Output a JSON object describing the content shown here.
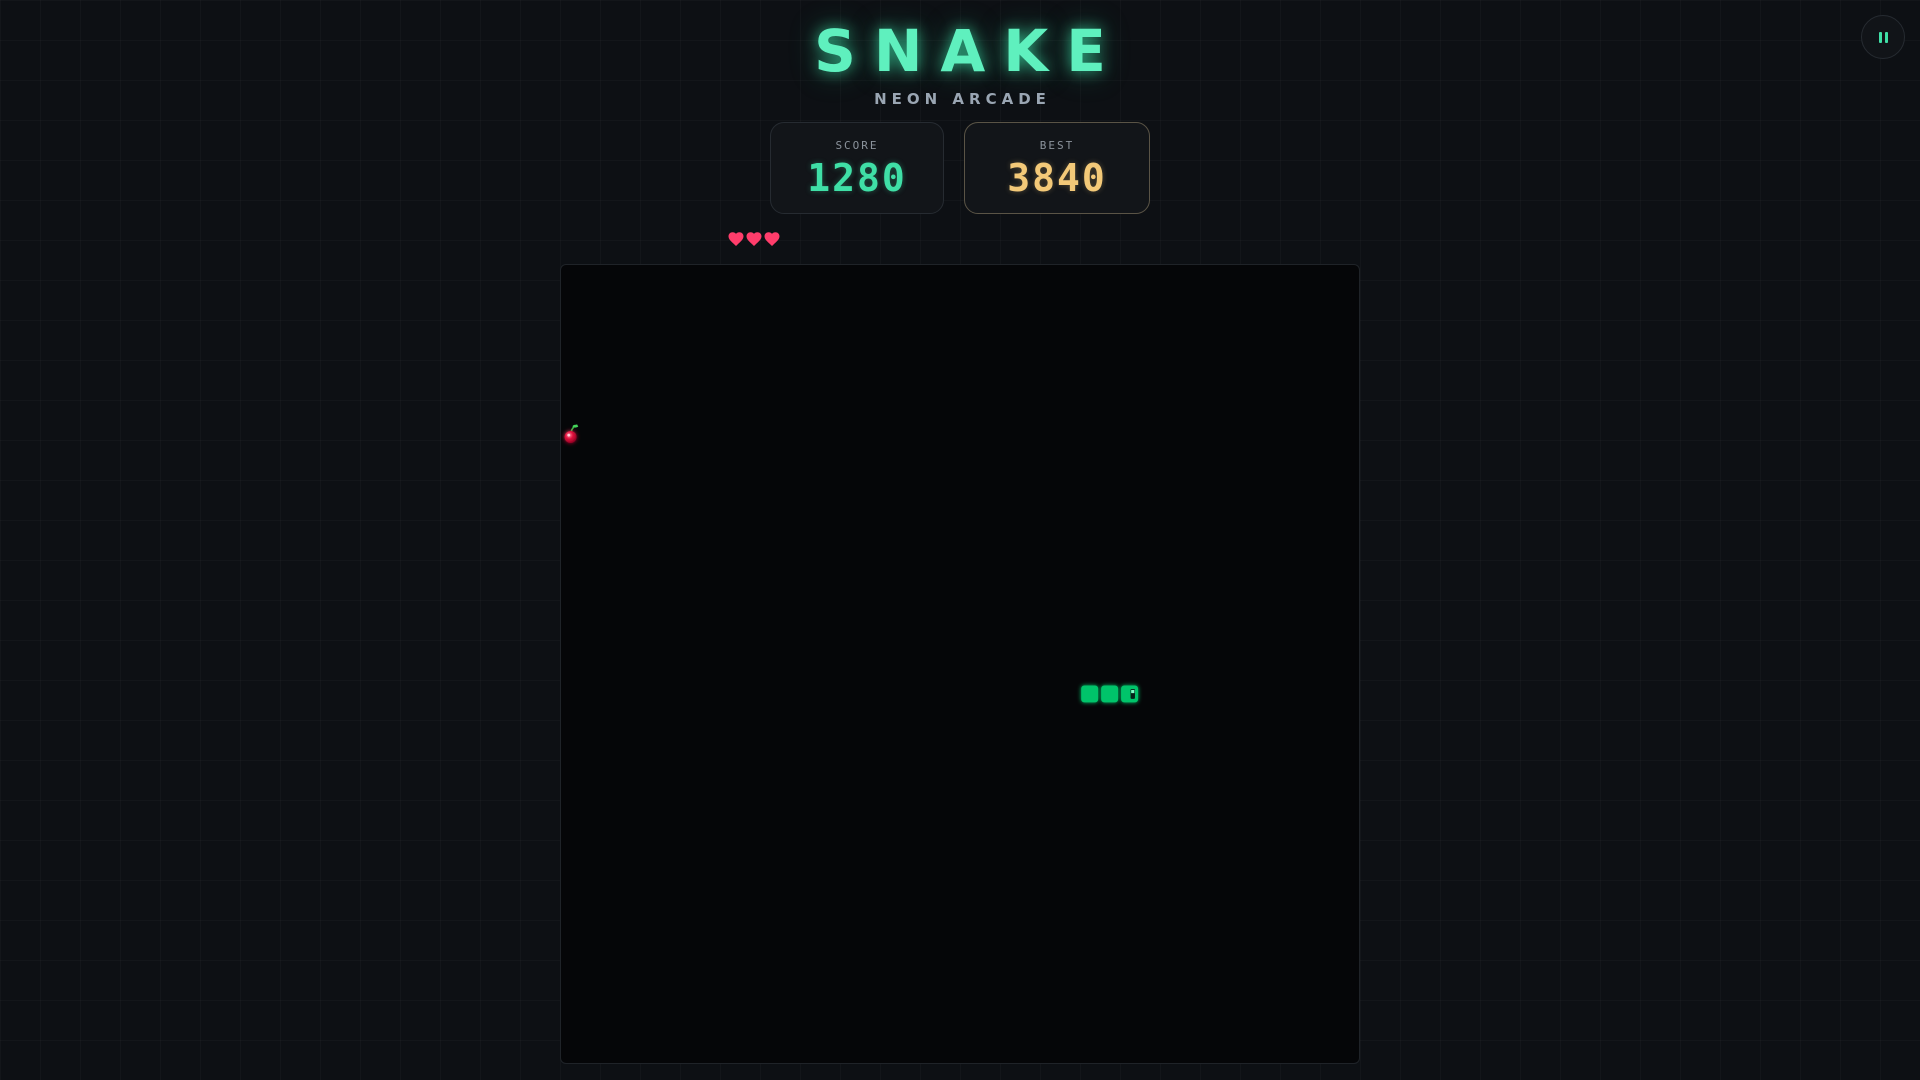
{
  "header": {
    "title": "SNAKE",
    "subtitle": "NEON ARCADE"
  },
  "scores": {
    "score_label": "SCORE",
    "score_value": "1280",
    "best_label": "BEST",
    "best_value": "3840"
  },
  "lives": {
    "count": 3,
    "icon": "heart-icon",
    "color": "#ff3d6b"
  },
  "board": {
    "grid_columns": 40,
    "grid_rows": 40,
    "food": {
      "type": "cherry",
      "col": 0,
      "row": 8
    },
    "snake": {
      "direction": "right",
      "segments": [
        {
          "col": 28,
          "row": 21
        },
        {
          "col": 27,
          "row": 21
        },
        {
          "col": 26,
          "row": 21
        }
      ]
    }
  },
  "colors": {
    "accent": "#3fdfa6",
    "best": "#f3c978",
    "snake": "#00c46a",
    "food": "#e0103d"
  },
  "controls": {
    "pause_icon": "pause-icon"
  }
}
